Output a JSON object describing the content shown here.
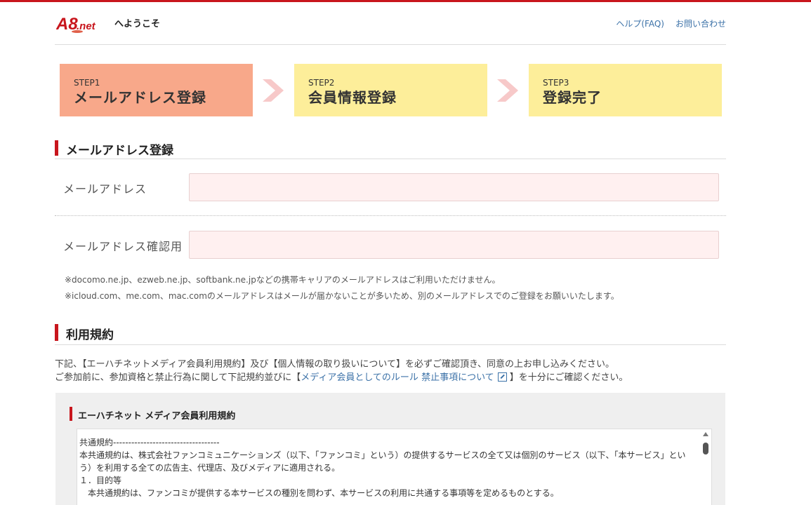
{
  "header": {
    "logo_text": "A8.net",
    "welcome": "へようこそ",
    "links": [
      "ヘルプ(FAQ)",
      "お問い合わせ"
    ]
  },
  "steps": [
    {
      "label": "STEP1",
      "title": "メールアドレス登録",
      "active": true
    },
    {
      "label": "STEP2",
      "title": "会員情報登録",
      "active": false
    },
    {
      "label": "STEP3",
      "title": "登録完了",
      "active": false
    }
  ],
  "email_section": {
    "title": "メールアドレス登録",
    "email_label": "メールアドレス",
    "email_value": "",
    "confirm_label": "メールアドレス確認用",
    "confirm_value": "",
    "notes": [
      "※docomo.ne.jp、ezweb.ne.jp、softbank.ne.jpなどの携帯キャリアのメールアドレスはご利用いただけません。",
      "※icloud.com、me.com、mac.comのメールアドレスはメールが届かないことが多いため、別のメールアドレスでのご登録をお願いいたします。"
    ]
  },
  "terms_section": {
    "title": "利用規約",
    "intro_line1": "下記、【エーハチネットメディア会員利用規約】及び【個人情報の取り扱いについて】を必ずご確認頂き、同意の上お申し込みください。",
    "intro_line2_prefix": "ご参加前に、参加資格と禁止行為に関して下記規約並びに【",
    "intro_line2_link": "メディア会員としてのルール 禁止事項について",
    "intro_line2_suffix": "】を十分にご確認ください。",
    "box_title": "エーハチネット メディア会員利用規約",
    "box_text": [
      "共通規約-----------------------------------",
      "本共通規約は、株式会社ファンコミュニケーションズ（以下、「ファンコミ」という）の提供するサービスの全て又は個別のサービス（以下、「本サービス」とい",
      "う）を利用する全ての広告主、代理店、及びメディアに適用される。",
      "",
      "１．目的等",
      "　本共通規約は、ファンコミが提供する本サービスの種別を問わず、本サービスの利用に共通する事項等を定めるものとする。"
    ]
  },
  "colors": {
    "brand_red": "#c8161d",
    "step_active": "#f8a88a",
    "step_inactive": "#fdee9a",
    "input_bg": "#fff0f0",
    "link": "#3c72a8"
  }
}
